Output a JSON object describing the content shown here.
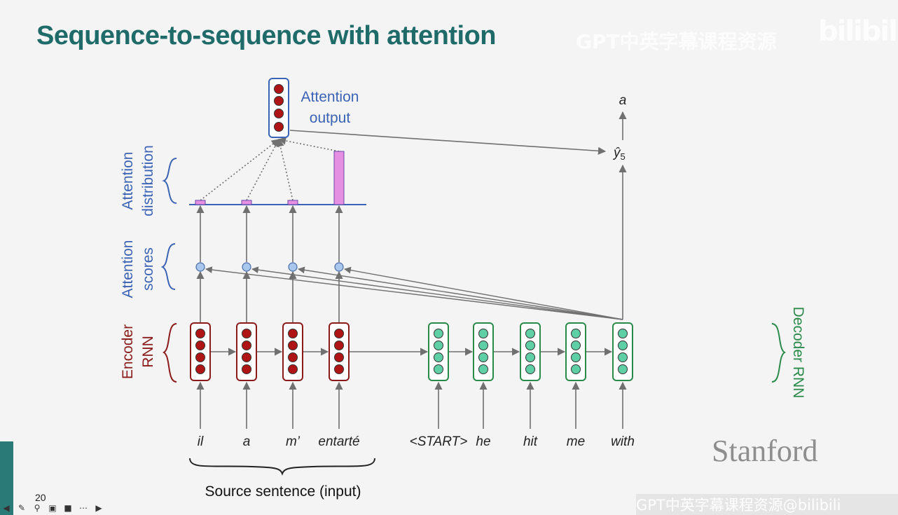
{
  "slide": {
    "title": "Sequence-to-sequence with attention",
    "page_number": "20",
    "logo_text": "Stanford"
  },
  "watermarks": {
    "top": "GPT中英字幕课程资源",
    "logo": "bilibili",
    "bottom": "GPT中英字幕课程资源@bilibili"
  },
  "labels": {
    "attention_output_line1": "Attention",
    "attention_output_line2": "output",
    "attention_distribution_line1": "Attention",
    "attention_distribution_line2": "distribution",
    "attention_scores_line1": "Attention",
    "attention_scores_line2": "scores",
    "encoder_line1": "Encoder",
    "encoder_line2": "RNN",
    "decoder": "Decoder RNN",
    "source_sentence": "Source sentence (input)",
    "y_hat": "ŷ",
    "y_sub": "5",
    "output_word": "a"
  },
  "encoder_words": [
    "il",
    "a",
    "m’",
    "entarté"
  ],
  "decoder_words": [
    "<START>",
    "he",
    "hit",
    "me",
    "with"
  ],
  "attention_weights": [
    0.08,
    0.08,
    0.08,
    1.0
  ],
  "colors": {
    "title": "#1f6b6a",
    "blue_label": "#3b63b5",
    "encoder": "#8b1a1a",
    "encoder_dot": "#b01515",
    "decoder": "#2a8a4a",
    "decoder_dot": "#5fd0a6",
    "bar": "#e58fe3",
    "score_dot": "#a9c7ec",
    "arrow": "#707070"
  },
  "toolbar_icons": [
    "back-icon",
    "pen-icon",
    "zoom-icon",
    "captions-icon",
    "video-icon",
    "more-icon",
    "forward-icon"
  ]
}
